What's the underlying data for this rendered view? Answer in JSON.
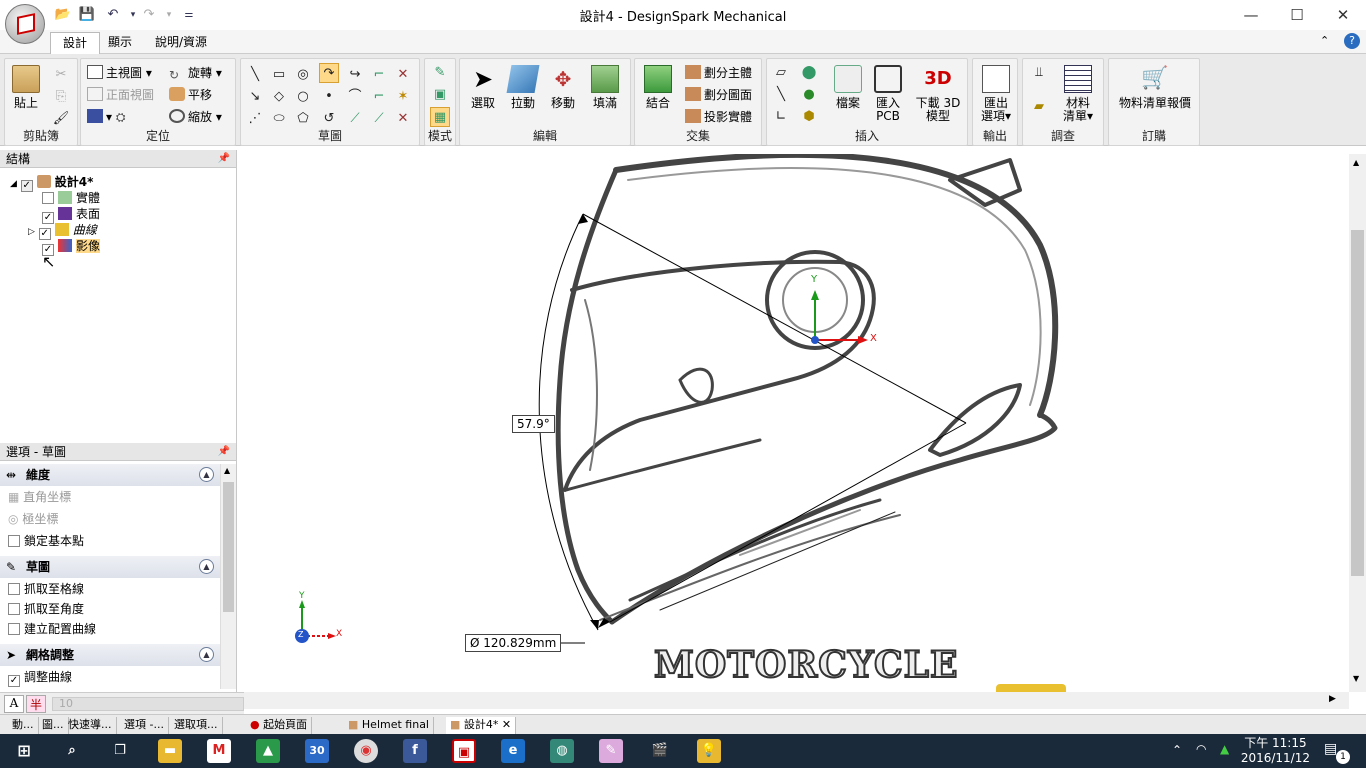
{
  "window": {
    "title": "設計4 - DesignSpark Mechanical"
  },
  "tabs": [
    "設計",
    "顯示",
    "說明/資源"
  ],
  "ribbon": {
    "clipboard": {
      "label": "剪貼簿",
      "paste": "貼上"
    },
    "orient": {
      "label": "定位",
      "home": "主視圖",
      "front": "正面視圖",
      "spin": "旋轉",
      "pan": "平移",
      "zoom": "縮放"
    },
    "sketch": {
      "label": "草圖"
    },
    "mode": {
      "label": "模式"
    },
    "edit": {
      "label": "編輯",
      "select": "選取",
      "pull": "拉動",
      "move": "移動",
      "fill": "填滿"
    },
    "intersect": {
      "label": "交集",
      "combine": "結合",
      "split_body": "劃分主體",
      "split_face": "劃分圖面",
      "project": "投影實體"
    },
    "insert": {
      "label": "插入",
      "file": "檔案",
      "pcb_1": "匯入",
      "pcb_2": "PCB",
      "dl_1": "下載 3D",
      "dl_2": "模型"
    },
    "output": {
      "label": "輸出",
      "export_1": "匯出",
      "export_2": "選項"
    },
    "investigate": {
      "label": "調查",
      "bom_1": "材料",
      "bom_2": "清單"
    },
    "order": {
      "label": "訂購",
      "quote": "物料清單報價"
    }
  },
  "structure": {
    "title": "結構",
    "root": "設計4*",
    "items": [
      "實體",
      "表面",
      "曲線",
      "影像"
    ]
  },
  "options": {
    "title": "選項 - 草圖",
    "sections": [
      {
        "title": "維度",
        "items": [
          "直角坐標",
          "極坐標",
          "鎖定基本點"
        ]
      },
      {
        "title": "草圖",
        "items": [
          "抓取至格線",
          "抓取至角度",
          "建立配置曲線"
        ]
      },
      {
        "title": "網格調整",
        "items": [
          "調整曲線"
        ]
      }
    ]
  },
  "canvas": {
    "angle_dim": "57.9°",
    "diameter_dim": "Ø  120.829mm",
    "image_text": "MOTORCYCLE",
    "axis_x": "X",
    "axis_y": "Y",
    "axis_z": "Z"
  },
  "mini_bar": {
    "value": "10"
  },
  "bottom_tabs": [
    "動...",
    "圖...",
    "快速導...",
    "選項 -...",
    "選取項...",
    "起始頁面",
    "Helmet final",
    "設計4*"
  ],
  "taskbar": {
    "time": "下午 11:15",
    "date": "2016/11/12",
    "notifications": "1",
    "calendar_day": "30"
  },
  "colors": {
    "accent": "#ffd98a",
    "taskbar": "#1b2a3a",
    "logo_red": "#cc0000"
  }
}
